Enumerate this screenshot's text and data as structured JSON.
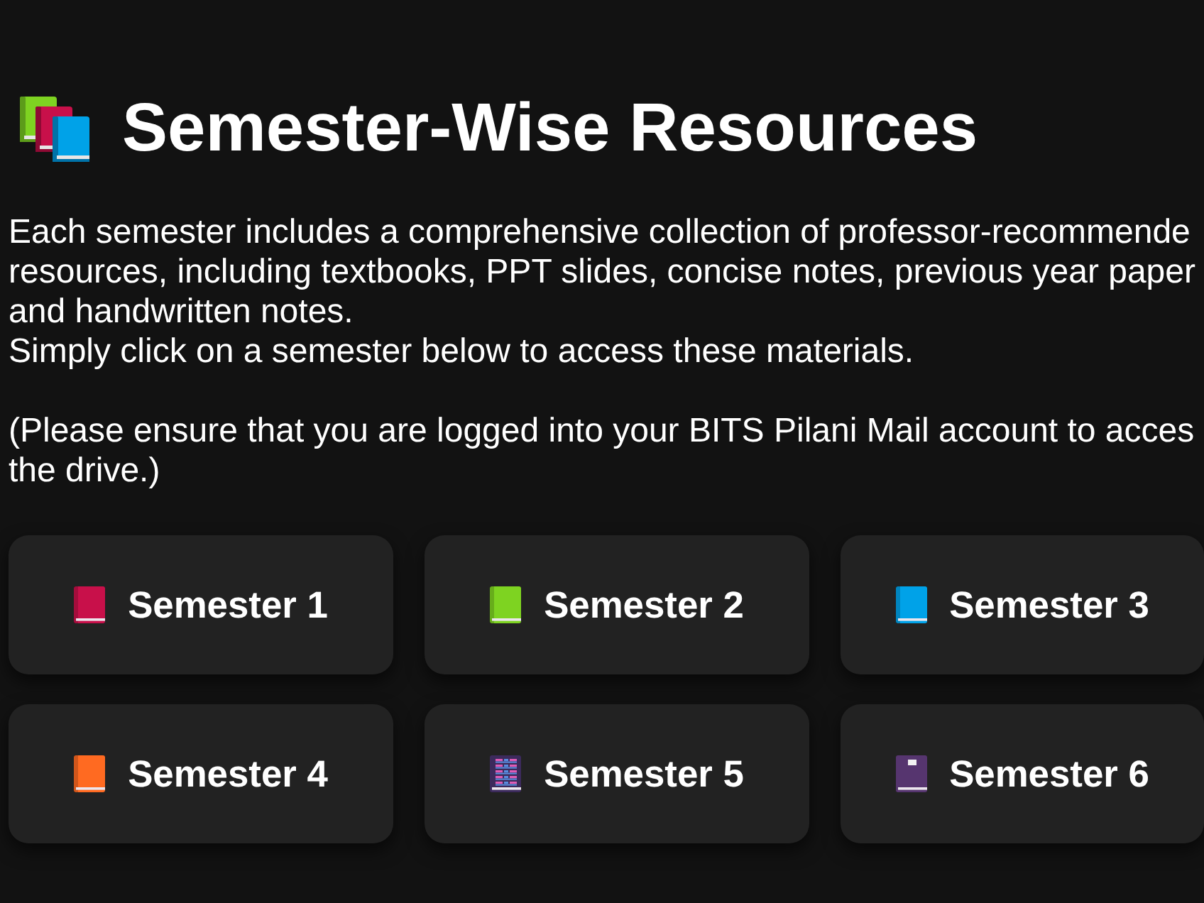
{
  "header": {
    "title": "Semester-Wise Resources"
  },
  "description": {
    "lines": [
      "Each semester includes a comprehensive collection of professor-recommende",
      "resources, including textbooks, PPT slides, concise notes, previous year paper",
      "and handwritten notes.",
      "Simply click on a semester below to access these materials."
    ]
  },
  "note": {
    "lines": [
      "(Please ensure that you are logged into your BITS Pilani Mail account to acces",
      "the drive.)"
    ]
  },
  "semesters": [
    {
      "label": "Semester 1",
      "kind": "book",
      "color": "#c8104a"
    },
    {
      "label": "Semester 2",
      "kind": "book",
      "color": "#7ed321"
    },
    {
      "label": "Semester 3",
      "kind": "book",
      "color": "#00a2e8"
    },
    {
      "label": "Semester 4",
      "kind": "book",
      "color": "#ff6a21"
    },
    {
      "label": "Semester 5",
      "kind": "notebook",
      "color": "#3c2a5c"
    },
    {
      "label": "Semester 6",
      "kind": "journal",
      "color": "#56356f"
    }
  ]
}
